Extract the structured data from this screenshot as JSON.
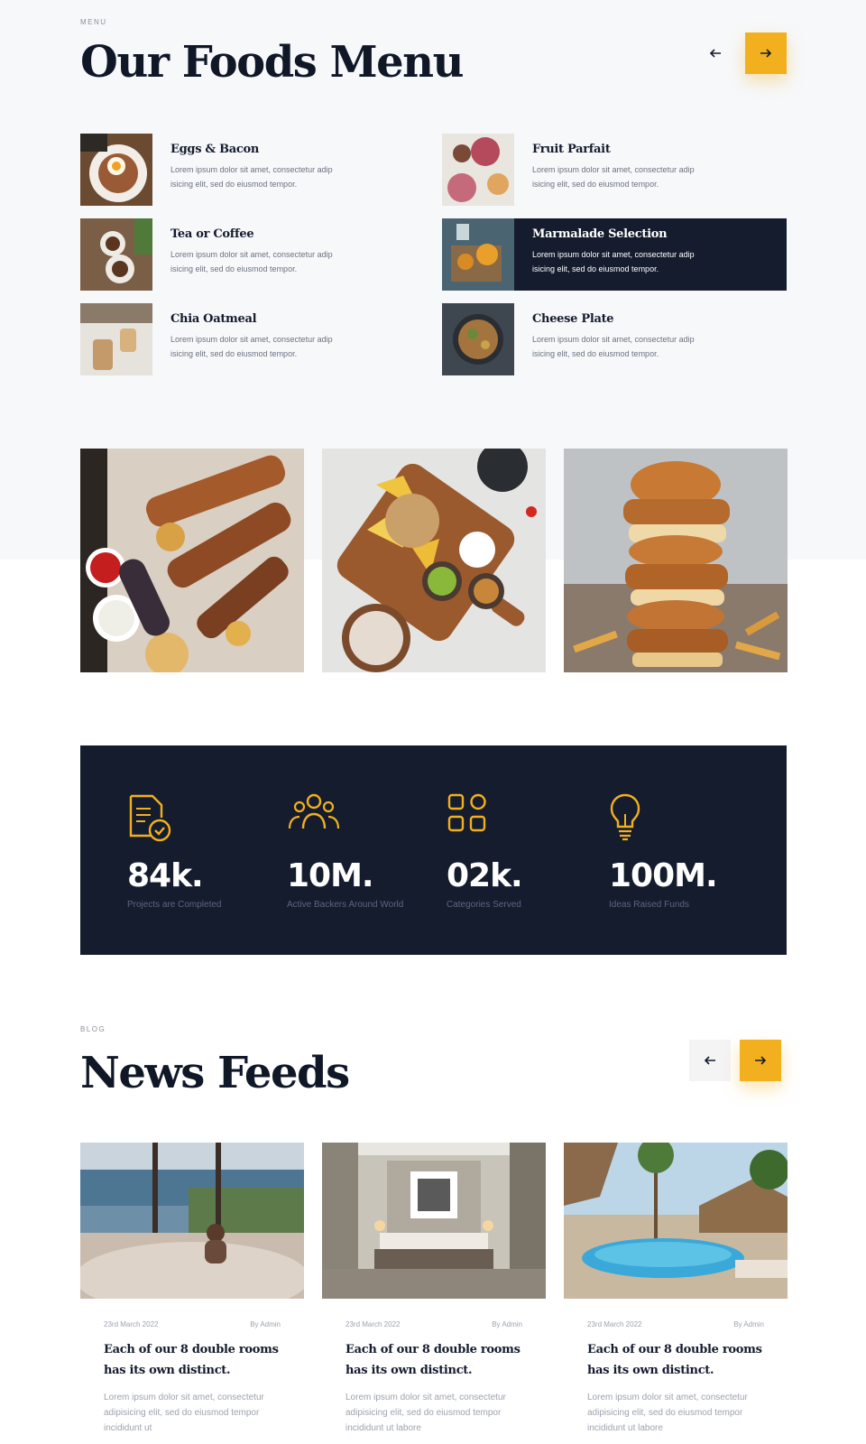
{
  "menu_section": {
    "eyebrow": "MENU",
    "title": "Our Foods Menu",
    "prev_icon": "arrow-left-icon",
    "next_icon": "arrow-right-icon",
    "items": [
      {
        "name": "Eggs & Bacon",
        "desc": "Lorem ipsum dolor sit amet, consectetur adip isicing elit, sed do eiusmod tempor."
      },
      {
        "name": "Fruit Parfait",
        "desc": "Lorem ipsum dolor sit amet, consectetur adip isicing elit, sed do eiusmod tempor."
      },
      {
        "name": "Tea or Coffee",
        "desc": "Lorem ipsum dolor sit amet, consectetur adip isicing elit, sed do eiusmod tempor."
      },
      {
        "name": "Marmalade Selection",
        "desc": "Lorem ipsum dolor sit amet, consectetur adip isicing elit, sed do eiusmod tempor."
      },
      {
        "name": "Chia Oatmeal",
        "desc": "Lorem ipsum dolor sit amet, consectetur adip isicing elit, sed do eiusmod tempor."
      },
      {
        "name": "Cheese Plate",
        "desc": "Lorem ipsum dolor sit amet, consectetur adip isicing elit, sed do eiusmod tempor."
      }
    ]
  },
  "stats": [
    {
      "icon": "document-check-icon",
      "value": "84k.",
      "label": "Projects are Completed"
    },
    {
      "icon": "users-group-icon",
      "value": "10M.",
      "label": "Active Backers Around World"
    },
    {
      "icon": "grid-categories-icon",
      "value": "02k.",
      "label": "Categories Served"
    },
    {
      "icon": "lightbulb-icon",
      "value": "100M.",
      "label": "Ideas Raised Funds"
    }
  ],
  "news_section": {
    "eyebrow": "BLOG",
    "title": "News Feeds",
    "cards": [
      {
        "date": "23rd March 2022",
        "author": "By Admin",
        "title": "Each of our 8 double rooms has its own distinct.",
        "excerpt": "Lorem ipsum dolor sit amet, consectetur adipisicing elit, sed do eiusmod tempor incididunt ut"
      },
      {
        "date": "23rd March 2022",
        "author": "By Admin",
        "title": "Each of our 8 double rooms has its own distinct.",
        "excerpt": "Lorem ipsum dolor sit amet, consectetur adipisicing elit, sed do eiusmod tempor incididunt ut labore"
      },
      {
        "date": "23rd March 2022",
        "author": "By Admin",
        "title": "Each of our 8 double rooms has its own distinct.",
        "excerpt": "Lorem ipsum dolor sit amet, consectetur adipisicing elit, sed do eiusmod tempor incididunt ut labore"
      }
    ]
  },
  "colors": {
    "accent": "#f2b01e",
    "navy": "#141c2e"
  }
}
